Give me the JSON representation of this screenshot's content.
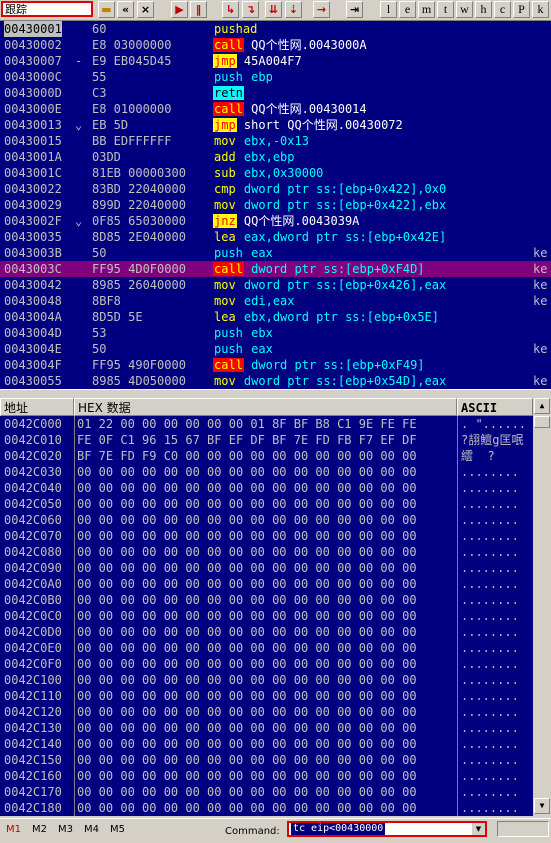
{
  "toolbar": {
    "title": "跟踪",
    "buttons": [
      "rewind",
      "back",
      "close",
      "run",
      "pause",
      "step-into",
      "step-over",
      "trace-into",
      "trace-over",
      "execute-till-return",
      "goto"
    ],
    "letter_buttons": [
      "l",
      "e",
      "m",
      "t",
      "w",
      "h",
      "c",
      "P",
      "k"
    ]
  },
  "disasm": {
    "rows": [
      {
        "addr": "00430001",
        "mark": "",
        "hex": "60",
        "mn": "pushad",
        "ops": "",
        "type": "y",
        "addr_hl": true
      },
      {
        "addr": "00430002",
        "mark": "",
        "hex": "E8 03000000",
        "mn": "call",
        "ops": "QQ个性网.0043000A",
        "type": "call"
      },
      {
        "addr": "00430007",
        "mark": "-",
        "hex": "E9 EB045D45",
        "mn": "jmp",
        "ops": "45A004F7",
        "type": "jmp"
      },
      {
        "addr": "0043000C",
        "mark": "",
        "hex": "55",
        "mn": "push",
        "ops": "ebp",
        "type": "stk"
      },
      {
        "addr": "0043000D",
        "mark": "",
        "hex": "C3",
        "mn": "retn",
        "ops": "",
        "type": "ret"
      },
      {
        "addr": "0043000E",
        "mark": "",
        "hex": "E8 01000000",
        "mn": "call",
        "ops": "QQ个性网.00430014",
        "type": "call"
      },
      {
        "addr": "00430013",
        "mark": "⌄",
        "hex": "EB 5D",
        "mn": "jmp",
        "ops": "short QQ个性网.00430072",
        "type": "jmp"
      },
      {
        "addr": "00430015",
        "mark": "",
        "hex": "BB EDFFFFFF",
        "mn": "mov",
        "ops": "ebx,-0x13",
        "type": "nor"
      },
      {
        "addr": "0043001A",
        "mark": "",
        "hex": "03DD",
        "mn": "add",
        "ops": "ebx,ebp",
        "type": "nor"
      },
      {
        "addr": "0043001C",
        "mark": "",
        "hex": "81EB 00000300",
        "mn": "sub",
        "ops": "ebx,0x30000",
        "type": "nor"
      },
      {
        "addr": "00430022",
        "mark": "",
        "hex": "83BD 22040000",
        "mn": "cmp",
        "ops": "dword ptr ss:[ebp+0x422],0x0",
        "type": "nor"
      },
      {
        "addr": "00430029",
        "mark": "",
        "hex": "899D 22040000",
        "mn": "mov",
        "ops": "dword ptr ss:[ebp+0x422],ebx",
        "type": "nor"
      },
      {
        "addr": "0043002F",
        "mark": "⌄",
        "hex": "0F85 65030000",
        "mn": "jnz",
        "ops": "QQ个性网.0043039A",
        "type": "jmp"
      },
      {
        "addr": "00430035",
        "mark": "",
        "hex": "8D85 2E040000",
        "mn": "lea",
        "ops": "eax,dword ptr ss:[ebp+0x42E]",
        "type": "nor"
      },
      {
        "addr": "0043003B",
        "mark": "",
        "hex": "50",
        "mn": "push",
        "ops": "eax",
        "type": "stk",
        "cmt": "ke"
      },
      {
        "addr": "0043003C",
        "mark": "",
        "hex": "FF95 4D0F0000",
        "mn": "call",
        "ops": "dword ptr ss:[ebp+0xF4D]",
        "type": "call",
        "sel": true,
        "cmt": "ke"
      },
      {
        "addr": "00430042",
        "mark": "",
        "hex": "8985 26040000",
        "mn": "mov",
        "ops": "dword ptr ss:[ebp+0x426],eax",
        "type": "nor",
        "cmt": "ke"
      },
      {
        "addr": "00430048",
        "mark": "",
        "hex": "8BF8",
        "mn": "mov",
        "ops": "edi,eax",
        "type": "nor",
        "cmt": "ke"
      },
      {
        "addr": "0043004A",
        "mark": "",
        "hex": "8D5D 5E",
        "mn": "lea",
        "ops": "ebx,dword ptr ss:[ebp+0x5E]",
        "type": "nor"
      },
      {
        "addr": "0043004D",
        "mark": "",
        "hex": "53",
        "mn": "push",
        "ops": "ebx",
        "type": "stk"
      },
      {
        "addr": "0043004E",
        "mark": "",
        "hex": "50",
        "mn": "push",
        "ops": "eax",
        "type": "stk",
        "cmt": "ke"
      },
      {
        "addr": "0043004F",
        "mark": "",
        "hex": "FF95 490F0000",
        "mn": "call",
        "ops": "dword ptr ss:[ebp+0xF49]",
        "type": "call"
      },
      {
        "addr": "00430055",
        "mark": "",
        "hex": "8985 4D050000",
        "mn": "mov",
        "ops": "dword ptr ss:[ebp+0x54D],eax",
        "type": "nor",
        "cmt": "ke"
      }
    ]
  },
  "dump": {
    "header_addr": "地址",
    "header_hex": "HEX 数据",
    "header_ascii": "ASCII",
    "rows": [
      {
        "addr": "0042C000",
        "hex": "01 22 00 00 00 00 00 00 01 8F BF B8 C1 9E FE FE",
        "ascii": ". \"......"
      },
      {
        "addr": "0042C010",
        "hex": "FE 0F C1 96 15 67 BF EF DF BF 7E FD FB F7 EF DF",
        "ascii": "?翓鱣g匡呡"
      },
      {
        "addr": "0042C020",
        "hex": "BF 7E FD F9 C0 00 00 00 00 00 00 00 00 00 00 00",
        "ascii": "繧  ?"
      },
      {
        "addr": "0042C030",
        "hex": "00 00 00 00 00 00 00 00 00 00 00 00 00 00 00 00",
        "ascii": "........"
      },
      {
        "addr": "0042C040",
        "hex": "00 00 00 00 00 00 00 00 00 00 00 00 00 00 00 00",
        "ascii": "........"
      },
      {
        "addr": "0042C050",
        "hex": "00 00 00 00 00 00 00 00 00 00 00 00 00 00 00 00",
        "ascii": "........"
      },
      {
        "addr": "0042C060",
        "hex": "00 00 00 00 00 00 00 00 00 00 00 00 00 00 00 00",
        "ascii": "........"
      },
      {
        "addr": "0042C070",
        "hex": "00 00 00 00 00 00 00 00 00 00 00 00 00 00 00 00",
        "ascii": "........"
      },
      {
        "addr": "0042C080",
        "hex": "00 00 00 00 00 00 00 00 00 00 00 00 00 00 00 00",
        "ascii": "........"
      },
      {
        "addr": "0042C090",
        "hex": "00 00 00 00 00 00 00 00 00 00 00 00 00 00 00 00",
        "ascii": "........"
      },
      {
        "addr": "0042C0A0",
        "hex": "00 00 00 00 00 00 00 00 00 00 00 00 00 00 00 00",
        "ascii": "........"
      },
      {
        "addr": "0042C0B0",
        "hex": "00 00 00 00 00 00 00 00 00 00 00 00 00 00 00 00",
        "ascii": "........"
      },
      {
        "addr": "0042C0C0",
        "hex": "00 00 00 00 00 00 00 00 00 00 00 00 00 00 00 00",
        "ascii": "........"
      },
      {
        "addr": "0042C0D0",
        "hex": "00 00 00 00 00 00 00 00 00 00 00 00 00 00 00 00",
        "ascii": "........"
      },
      {
        "addr": "0042C0E0",
        "hex": "00 00 00 00 00 00 00 00 00 00 00 00 00 00 00 00",
        "ascii": "........"
      },
      {
        "addr": "0042C0F0",
        "hex": "00 00 00 00 00 00 00 00 00 00 00 00 00 00 00 00",
        "ascii": "........"
      },
      {
        "addr": "0042C100",
        "hex": "00 00 00 00 00 00 00 00 00 00 00 00 00 00 00 00",
        "ascii": "........"
      },
      {
        "addr": "0042C110",
        "hex": "00 00 00 00 00 00 00 00 00 00 00 00 00 00 00 00",
        "ascii": "........"
      },
      {
        "addr": "0042C120",
        "hex": "00 00 00 00 00 00 00 00 00 00 00 00 00 00 00 00",
        "ascii": "........"
      },
      {
        "addr": "0042C130",
        "hex": "00 00 00 00 00 00 00 00 00 00 00 00 00 00 00 00",
        "ascii": "........"
      },
      {
        "addr": "0042C140",
        "hex": "00 00 00 00 00 00 00 00 00 00 00 00 00 00 00 00",
        "ascii": "........"
      },
      {
        "addr": "0042C150",
        "hex": "00 00 00 00 00 00 00 00 00 00 00 00 00 00 00 00",
        "ascii": "........"
      },
      {
        "addr": "0042C160",
        "hex": "00 00 00 00 00 00 00 00 00 00 00 00 00 00 00 00",
        "ascii": "........"
      },
      {
        "addr": "0042C170",
        "hex": "00 00 00 00 00 00 00 00 00 00 00 00 00 00 00 00",
        "ascii": "........"
      },
      {
        "addr": "0042C180",
        "hex": "00 00 00 00 00 00 00 00 00 00 00 00 00 00 00 00",
        "ascii": "........"
      }
    ]
  },
  "status": {
    "tabs": [
      "M1",
      "M2",
      "M3",
      "M4",
      "M5"
    ],
    "command_label": "Command:",
    "command_value": "tc eip<00430000"
  },
  "colors": {
    "pane_bg": "#000080",
    "selected_row": "#800080",
    "highlight_box": "#e00000"
  }
}
